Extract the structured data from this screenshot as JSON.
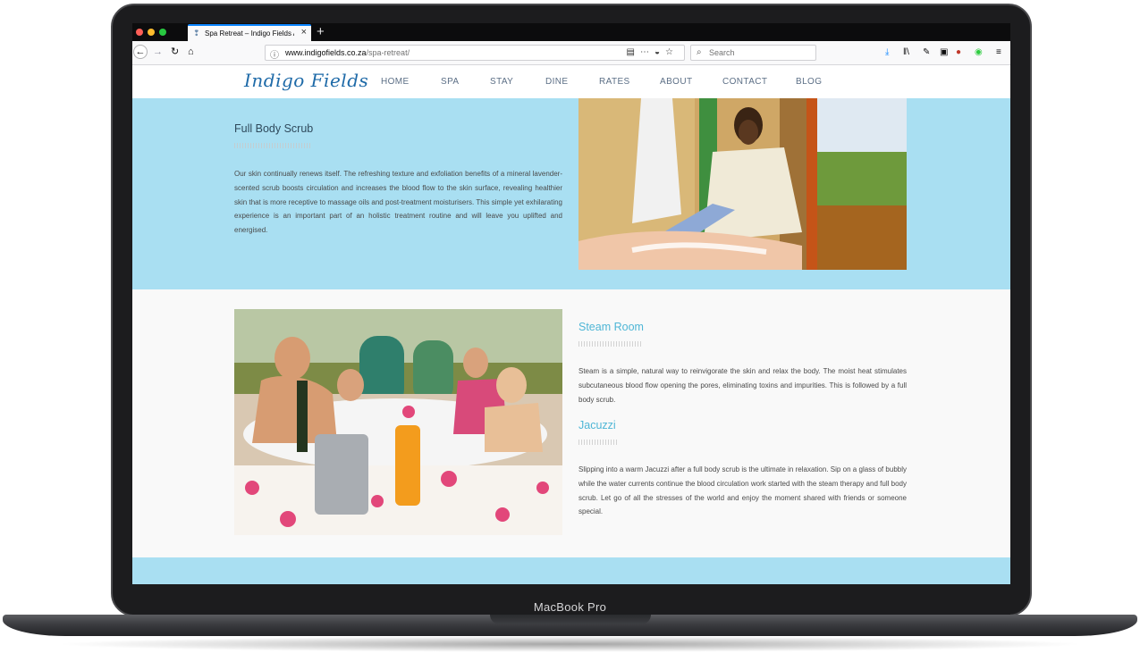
{
  "device": {
    "brand_label": "MacBook Pro"
  },
  "browser": {
    "tab_title": "Spa Retreat – Indigo Fields Afri",
    "new_tab_label": "+",
    "url_scheme_host": "www.indigofields.co.za",
    "url_path": "/spa-retreat/",
    "search_placeholder": "Search"
  },
  "site": {
    "logo_text": "Indigo Fields",
    "nav": [
      "HOME",
      "SPA",
      "STAY",
      "DINE",
      "RATES",
      "ABOUT",
      "CONTACT",
      "BLOG"
    ]
  },
  "sections": {
    "body_scrub": {
      "title": "Full Body Scrub",
      "text": "Our skin continually renews itself.  The refreshing texture and exfoliation benefits of a mineral lavender-scented scrub boosts circulation and increases the blood flow to the skin surface, revealing healthier skin that is more receptive to massage oils and post-treatment moisturisers. This simple yet exhilarating experience is an important part of an holistic treatment routine and will leave you uplifted and energised."
    },
    "steam_room": {
      "title": "Steam Room",
      "text": "Steam is a simple, natural way to reinvigorate the skin and relax the body. The moist heat stimulates subcutaneous blood flow opening the pores, eliminating toxins and impurities. This is followed by a full body scrub."
    },
    "jacuzzi": {
      "title": "Jacuzzi",
      "text": "Slipping into a warm Jacuzzi after a full body scrub is the ultimate in relaxation. Sip on a glass of bubbly while the water currents continue the blood circulation work started with the steam therapy and full body scrub. Let go of all the stresses of the world and enjoy the moment shared with friends or someone special."
    }
  },
  "colors": {
    "section_blue": "#a9dff2",
    "heading_blue": "#4fb6d6",
    "heading_dark": "#2f4a5c",
    "logo_blue": "#1e6aa8",
    "nav_text": "#5c6f86",
    "tab_accent": "#0a84ff"
  },
  "icons": {
    "tab_favicon": "favicon-icon",
    "tab_close": "close-icon",
    "back": "back-arrow-icon",
    "forward": "forward-arrow-icon",
    "reload": "reload-icon",
    "home": "home-icon",
    "page_info": "info-icon",
    "reader": "reader-view-icon",
    "page_actions": "more-icon",
    "pocket": "pocket-icon",
    "bookmark": "star-icon",
    "search": "search-icon",
    "download": "download-icon",
    "library": "library-icon",
    "menu": "hamburger-menu-icon"
  }
}
